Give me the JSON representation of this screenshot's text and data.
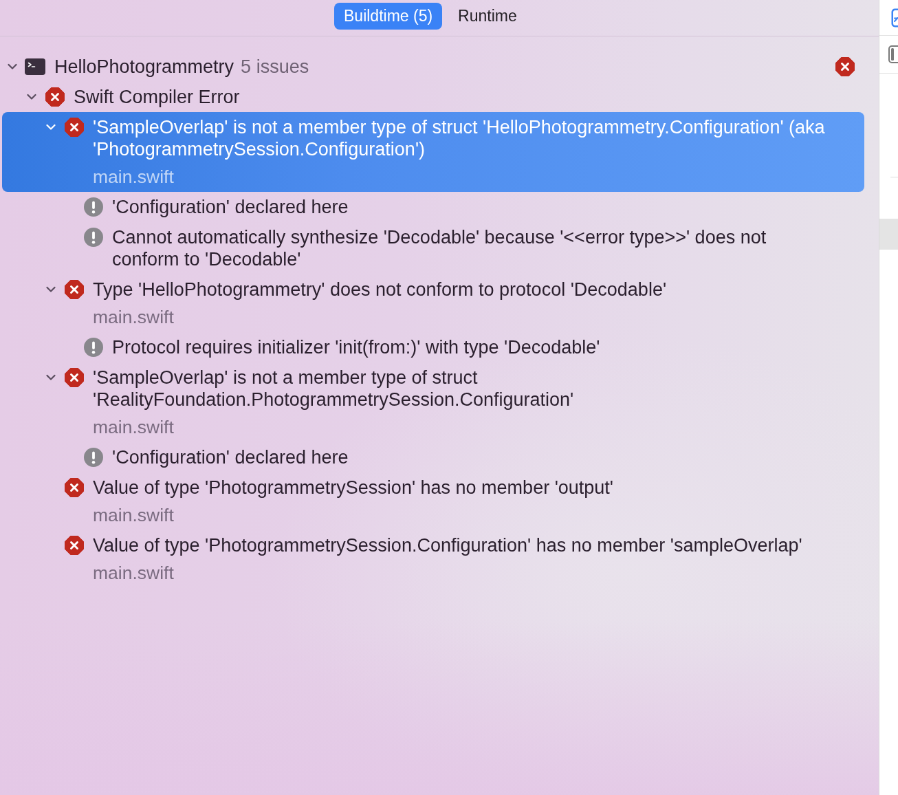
{
  "tabs": [
    {
      "label": "Buildtime (5)",
      "selected": true
    },
    {
      "label": "Runtime",
      "selected": false
    }
  ],
  "tree": [
    {
      "kind": "project",
      "label": "HelloPhotogrammetry",
      "count": "5 issues",
      "error_badge": true,
      "expanded": true,
      "selected": false,
      "children": [
        {
          "kind": "category",
          "label": "Swift Compiler Error",
          "expanded": true,
          "selected": false,
          "children": [
            {
              "kind": "error",
              "label": "'SampleOverlap' is not a member type of struct 'HelloPhotogrammetry.Configuration' (aka 'PhotogrammetrySession.Configuration')",
              "file": "main.swift",
              "expanded": true,
              "selected": true,
              "children": [
                {
                  "kind": "note",
                  "label": "'Configuration' declared here",
                  "selected": false
                },
                {
                  "kind": "note",
                  "label": "Cannot automatically synthesize 'Decodable' because '<<error type>>' does not conform to 'Decodable'",
                  "selected": false
                }
              ]
            },
            {
              "kind": "error",
              "label": "Type 'HelloPhotogrammetry' does not conform to protocol 'Decodable'",
              "file": "main.swift",
              "expanded": true,
              "selected": false,
              "children": [
                {
                  "kind": "note",
                  "label": "Protocol requires initializer 'init(from:)' with type 'Decodable'",
                  "selected": false
                }
              ]
            },
            {
              "kind": "error",
              "label": "'SampleOverlap' is not a member type of struct 'RealityFoundation.PhotogrammetrySession.Configuration'",
              "file": "main.swift",
              "expanded": true,
              "selected": false,
              "children": [
                {
                  "kind": "note",
                  "label": "'Configuration' declared here",
                  "selected": false
                }
              ]
            },
            {
              "kind": "error",
              "label": "Value of type 'PhotogrammetrySession' has no member 'output'",
              "file": "main.swift",
              "selected": false
            },
            {
              "kind": "error",
              "label": "Value of type 'PhotogrammetrySession.Configuration' has no member 'sampleOverlap'",
              "file": "main.swift",
              "selected": false
            }
          ]
        }
      ]
    }
  ]
}
